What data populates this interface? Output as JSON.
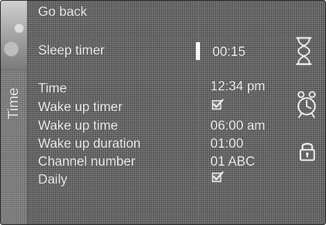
{
  "side_panel": {
    "label": "Time"
  },
  "menu": {
    "go_back": "Go back",
    "sleep_timer": "Sleep timer",
    "time": "Time",
    "wake_up_timer": "Wake up timer",
    "wake_up_time": "Wake up time",
    "wake_up_duration": "Wake up duration",
    "channel_number": "Channel number",
    "daily": "Daily"
  },
  "values": {
    "sleep_timer": "00:15",
    "time": "12:34 pm",
    "wake_up_timer_checked": true,
    "wake_up_time": "06:00 am",
    "wake_up_duration": "01:00",
    "channel_number": "01 ABC",
    "daily_checked": true
  },
  "icons": {
    "hourglass": "hourglass-icon",
    "alarm_clock": "alarm-clock-icon",
    "lock": "lock-icon"
  }
}
